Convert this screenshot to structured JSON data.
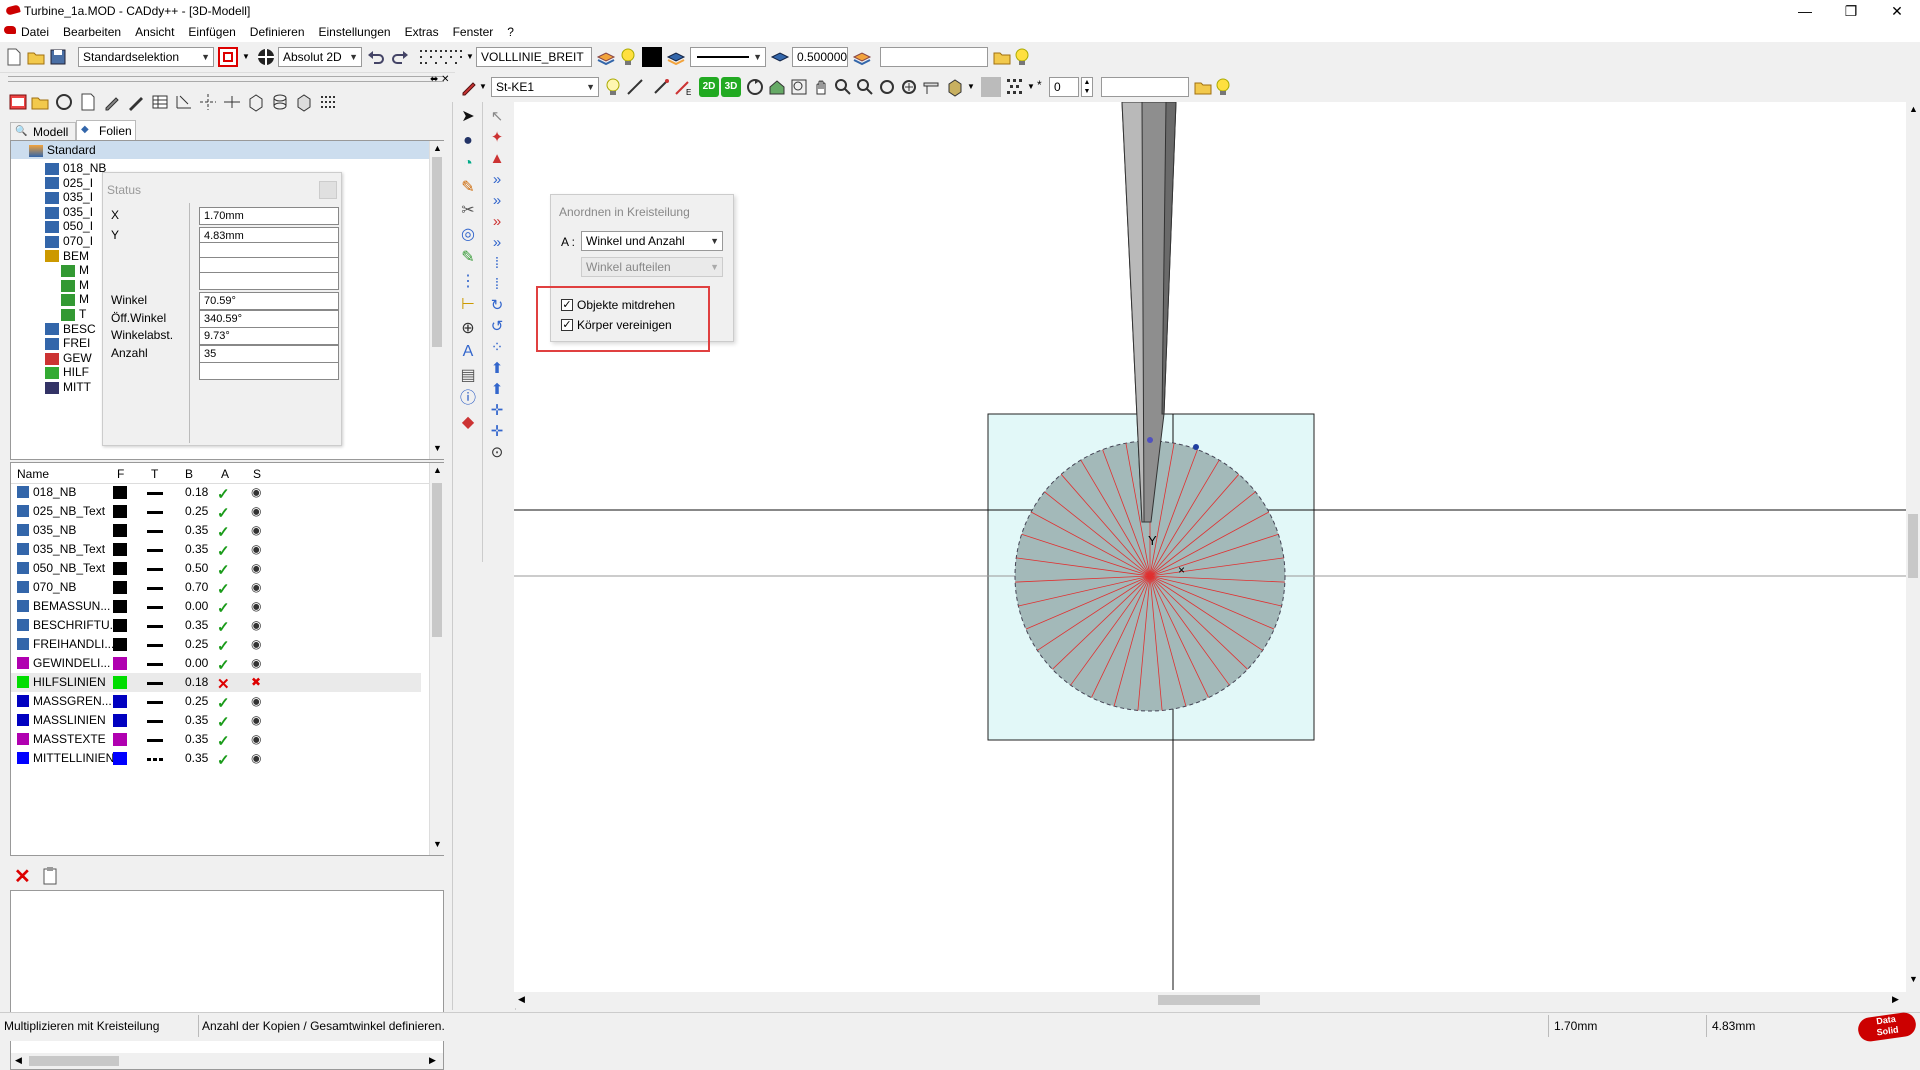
{
  "window": {
    "title": "Turbine_1a.MOD  -  CADdy++ - [3D-Modell]",
    "controls": {
      "minimize": "—",
      "restore": "❐",
      "close": "✕"
    }
  },
  "menu": {
    "items": [
      "Datei",
      "Bearbeiten",
      "Ansicht",
      "Einfügen",
      "Definieren",
      "Einstellungen",
      "Extras",
      "Fenster",
      "?"
    ]
  },
  "toolbar1": {
    "selection_mode": "Standardselektion",
    "coord_mode": "Absolut 2D",
    "line_style": "VOLLLINIE_BREIT",
    "line_width": "0.500000",
    "text_field": ""
  },
  "toolbar2": {
    "layer_select": "St-KE1",
    "btn_2d": "2D",
    "btn_3d": "3D",
    "number_value": "0",
    "text_field": ""
  },
  "left_panel": {
    "tabs": [
      {
        "label": "Modell"
      },
      {
        "label": "Folien"
      }
    ],
    "active_tab": "Folien",
    "tree": {
      "root": "Standard",
      "items": [
        "018_NB",
        "025_I",
        "035_I",
        "035_I",
        "050_I",
        "070_I",
        "BEM",
        "M",
        "M",
        "M",
        "T",
        "BESC",
        "FREI",
        "GEW",
        "HILF",
        "MITT"
      ]
    },
    "layer_table": {
      "columns": [
        "Name",
        "F",
        "T",
        "B",
        "A",
        "S"
      ],
      "rows": [
        {
          "name": "018_NB",
          "color": "#000000",
          "line": "solid",
          "width": "0.18",
          "active": "yes",
          "visible": "yes"
        },
        {
          "name": "025_NB_Text",
          "color": "#000000",
          "line": "solid",
          "width": "0.25",
          "active": "yes",
          "visible": "yes"
        },
        {
          "name": "035_NB",
          "color": "#000000",
          "line": "solid",
          "width": "0.35",
          "active": "yes",
          "visible": "yes"
        },
        {
          "name": "035_NB_Text",
          "color": "#000000",
          "line": "solid",
          "width": "0.35",
          "active": "yes",
          "visible": "yes"
        },
        {
          "name": "050_NB_Text",
          "color": "#000000",
          "line": "solid",
          "width": "0.50",
          "active": "yes",
          "visible": "yes"
        },
        {
          "name": "070_NB",
          "color": "#000000",
          "line": "solid",
          "width": "0.70",
          "active": "yes",
          "visible": "yes"
        },
        {
          "name": "BEMASSUN...",
          "color": "#000000",
          "line": "solid",
          "width": "0.00",
          "active": "yes",
          "visible": "yes"
        },
        {
          "name": "BESCHRIFTU...",
          "color": "#000000",
          "line": "solid",
          "width": "0.35",
          "active": "yes",
          "visible": "yes"
        },
        {
          "name": "FREIHANDLI...",
          "color": "#000000",
          "line": "solid",
          "width": "0.25",
          "active": "yes",
          "visible": "yes"
        },
        {
          "name": "GEWINDELI...",
          "color": "#b000b0",
          "line": "solid",
          "width": "0.00",
          "active": "yes",
          "visible": "yes"
        },
        {
          "name": "HILFSLINIEN",
          "color": "#00dd00",
          "line": "solid",
          "width": "0.18",
          "active": "no",
          "visible": "no"
        },
        {
          "name": "MASSGREN...",
          "color": "#0000c0",
          "line": "solid",
          "width": "0.25",
          "active": "yes",
          "visible": "yes"
        },
        {
          "name": "MASSLINIEN",
          "color": "#0000c0",
          "line": "solid",
          "width": "0.35",
          "active": "yes",
          "visible": "yes"
        },
        {
          "name": "MASSTEXTE",
          "color": "#b000b0",
          "line": "solid",
          "width": "0.35",
          "active": "yes",
          "visible": "yes"
        },
        {
          "name": "MITTELLINIEN",
          "color": "#0000ff",
          "line": "dashdot",
          "width": "0.35",
          "active": "yes",
          "visible": "yes"
        }
      ]
    }
  },
  "status_popup": {
    "title": "Status",
    "fields": [
      {
        "label": "X",
        "value": "1.70mm"
      },
      {
        "label": "Y",
        "value": "4.83mm"
      },
      {
        "label": "",
        "value": ""
      },
      {
        "label": "",
        "value": ""
      },
      {
        "label": "",
        "value": ""
      },
      {
        "label": "Winkel",
        "value": "70.59°"
      },
      {
        "label": "Öff.Winkel",
        "value": "340.59°"
      },
      {
        "label": "Winkelabst.",
        "value": "9.73°"
      },
      {
        "label": "Anzahl",
        "value": "35"
      },
      {
        "label": "",
        "value": ""
      }
    ]
  },
  "dialog": {
    "title": "Anordnen in Kreisteilung",
    "a_label": "A :",
    "mode_select": "Winkel und Anzahl",
    "sub_select": "Winkel aufteilen",
    "checkbox1": {
      "label": "Objekte mitdrehen",
      "checked": true
    },
    "checkbox2": {
      "label": "Körper vereinigen",
      "checked": true
    }
  },
  "canvas": {
    "axis_label_y": "Y",
    "axis_label_x": "×",
    "spoke_count": 35,
    "colors": {
      "box_fill": "#e2f8f8",
      "disc_fill": "#a3b9b9",
      "spoke": "#e03030",
      "highlight": "#e04040"
    }
  },
  "statusbar": {
    "command": "Multiplizieren mit Kreisteilung",
    "hint": "Anzahl der Kopien / Gesamtwinkel definieren.",
    "x": "1.70mm",
    "y": "4.83mm",
    "logo_line1": "Data",
    "logo_line2": "Solid"
  }
}
